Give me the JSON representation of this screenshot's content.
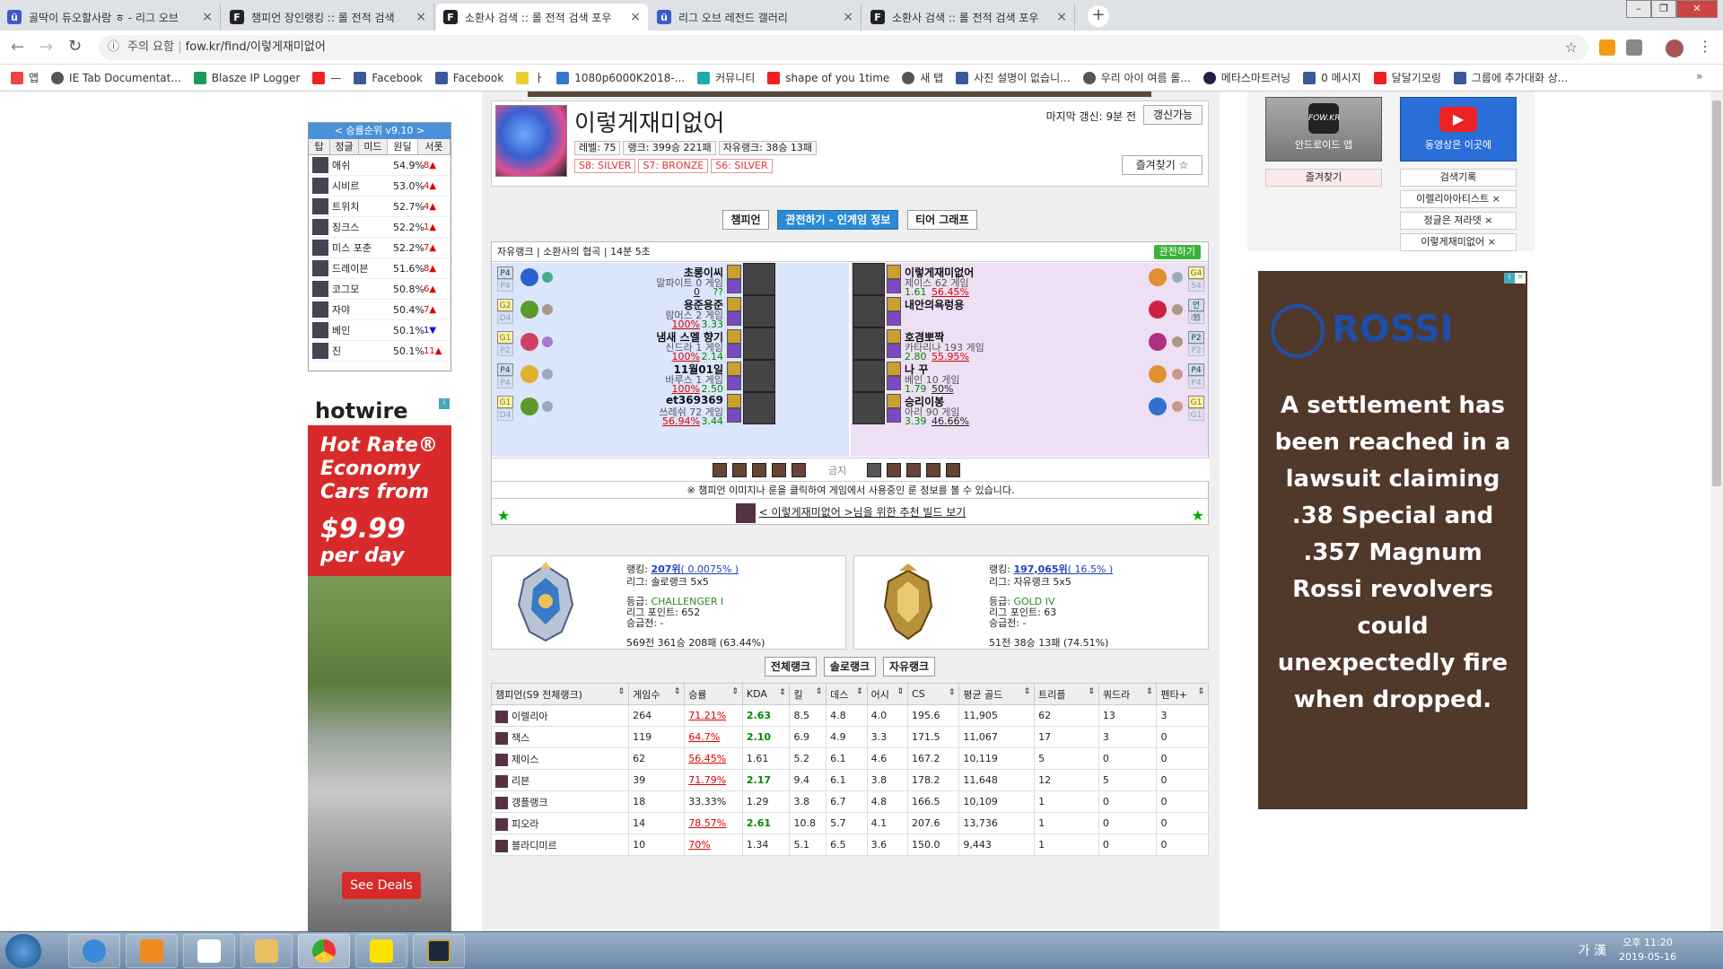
{
  "browser": {
    "tabs": [
      {
        "title": "골딱이 듀오할사람 ㅎ - 리그 오브",
        "icon": "op-icon",
        "color": "#3b5bcc"
      },
      {
        "title": "챔피언 장인랭킹 :: 롤 전적 검색",
        "icon": "fow-icon",
        "color": "#222"
      },
      {
        "title": "소환사 검색 :: 롤 전적 검색 포우",
        "icon": "fow-icon",
        "color": "#222",
        "active": true
      },
      {
        "title": "리그 오브 레전드 갤러리",
        "icon": "op-icon",
        "color": "#3b5bcc"
      },
      {
        "title": "소환사 검색 :: 롤 전적 검색 포우",
        "icon": "fow-icon",
        "color": "#222"
      }
    ],
    "url_warning": "주의 요함",
    "url": "fow.kr/find/이렇게재미없어",
    "bookmarks": [
      "앱",
      "IE Tab Documentat...",
      "Blasze IP Logger",
      "—",
      "Facebook",
      "Facebook",
      "ㅏ",
      "1080p6000K2018-...",
      "커뮤니티",
      "shape of you 1time",
      "새 탭",
      "사진 설명이 없습니...",
      "우리 아이 여름 롤...",
      "메타스마트러닝",
      "0 메시지",
      "달달기모링",
      "그룹에 추가대화 상..."
    ]
  },
  "winrank": {
    "title": "< 승률순위 v9.10 >",
    "cols": [
      "탑",
      "정글",
      "미드",
      "원딜",
      "서폿"
    ],
    "rows": [
      {
        "name": "애쉬",
        "wr": "54.9%",
        "ch": "8▲"
      },
      {
        "name": "시비르",
        "wr": "53.0%",
        "ch": "4▲"
      },
      {
        "name": "트위치",
        "wr": "52.7%",
        "ch": "4▲"
      },
      {
        "name": "징크스",
        "wr": "52.2%",
        "ch": "1▲"
      },
      {
        "name": "미스 포춘",
        "wr": "52.2%",
        "ch": "7▲"
      },
      {
        "name": "드레이븐",
        "wr": "51.6%",
        "ch": "8▲"
      },
      {
        "name": "코그모",
        "wr": "50.8%",
        "ch": "6▲"
      },
      {
        "name": "자야",
        "wr": "50.4%",
        "ch": "7▲"
      },
      {
        "name": "베인",
        "wr": "50.1%",
        "ch": "1▼"
      },
      {
        "name": "진",
        "wr": "50.1%",
        "ch": "11▲"
      }
    ]
  },
  "ad_left": {
    "brand": "hotwire",
    "line1": "Hot Rate®",
    "line2": "Economy",
    "line3": "Cars from",
    "price": "$9.99",
    "perday": "per day",
    "cta": "See Deals"
  },
  "profile": {
    "name": "이렇게재미없어",
    "level": "레벨: 75",
    "rank": "랭크: 399승 221패",
    "flex": "자유랭크: 38승 13패",
    "seasons": [
      "S8: SILVER",
      "S7: BRONZE",
      "S6: SILVER"
    ],
    "last_update": "마지막 갱신: 9분 전",
    "update_btn": "갱신가능",
    "fav_btn": "즐겨찾기 ☆"
  },
  "navtabs": [
    "챔피언",
    "관전하기 - 인게임 정보",
    "티어 그래프"
  ],
  "game": {
    "head": "자유랭크 | 소환사의 협곡 | 14분 5초",
    "spectate": "관전하기",
    "blue": [
      {
        "tier": "P4",
        "tier2": "P4",
        "name": "초롱이씨",
        "games": "말파이트 0 게임",
        "kda": "??",
        "wr": "0",
        "c1": "#2a60d0",
        "c2": "#4a8"
      },
      {
        "tier": "G2",
        "tier2": "D4",
        "name": "용준용준",
        "games": "람머스 2 게임",
        "kda": "3.33",
        "wr": "100%",
        "c1": "#5a9a2a",
        "c2": "#a98"
      },
      {
        "tier": "G1",
        "tier2": "P2",
        "name": "냄새 스멜 향기",
        "games": "신드라 1 게임",
        "kda": "2.14",
        "wr": "100%",
        "c1": "#d04060",
        "c2": "#a7c"
      },
      {
        "tier": "P4",
        "tier2": "P4",
        "name": "11월01일",
        "games": "바루스 1 게임",
        "kda": "2.50",
        "wr": "100%",
        "c1": "#e0b030",
        "c2": "#9ab"
      },
      {
        "tier": "G1",
        "tier2": "D4",
        "name": "et369369",
        "games": "쓰레쉬 72 게임",
        "kda": "3.44",
        "wr": "56.94%",
        "c1": "#5a9a2a",
        "c2": "#9ab"
      }
    ],
    "red": [
      {
        "tier": "G4",
        "tier2": "S4",
        "name": "이렇게재미없어",
        "games": "제이스 62 게임",
        "kda": "1.61",
        "wr": "56.45%",
        "c1": "#e09030",
        "c2": "#9ab"
      },
      {
        "tier": "언랭",
        "tier2": "D1",
        "name": "내안의욕렁용",
        "games": "",
        "kda": "",
        "wr": "",
        "c1": "#d02040",
        "c2": "#a98"
      },
      {
        "tier": "P2",
        "tier2": "P2",
        "name": "호겸뽀짝",
        "games": "카타리나 193 게임",
        "kda": "2.80",
        "wr": "55.95%",
        "c1": "#b03080",
        "c2": "#a98"
      },
      {
        "tier": "P4",
        "tier2": "P4",
        "name": "나 꾸",
        "games": "베인 10 게임",
        "kda": "1.79",
        "wr": "50%",
        "c1": "#e09030",
        "c2": "#c98"
      },
      {
        "tier": "G1",
        "tier2": "G1",
        "name": "승리이봉",
        "games": "아리 90 게임",
        "kda": "3.39",
        "wr": "46.66%",
        "c1": "#3070d0",
        "c2": "#c98"
      }
    ],
    "bans_label": "금지",
    "notice": "※ 챔피언 이미지나 룬을 클릭하여 게임에서 사용중인 룬 정보를 볼 수 있습니다.",
    "build_link": "< 이렇게재미없어 >님을 위한 추천 빌드 보기"
  },
  "rank_solo": {
    "rank_label": "랭킹:",
    "rank": "207위",
    "rank_pct": "( 0.0075% )",
    "league": "리그: 솔로랭크 5x5",
    "tier_label": "등급:",
    "tier": "CHALLENGER I",
    "lp": "리그 포인트: 652",
    "promo": "승급전: -",
    "record": "569전 361승 208패 (63.44%)"
  },
  "rank_flex": {
    "rank_label": "랭킹:",
    "rank": "197,065위",
    "rank_pct": "( 16.5% )",
    "league": "리그: 자유랭크 5x5",
    "tier_label": "등급:",
    "tier": "GOLD IV",
    "lp": "리그 포인트: 63",
    "promo": "승급전: -",
    "record": "51전 38승 13패 (74.51%)"
  },
  "rankbtns": [
    "전체랭크",
    "솔로랭크",
    "자유랭크"
  ],
  "stats": {
    "cols": [
      "챔피언(S9 전체랭크)",
      "게임수",
      "승률",
      "KDA",
      "킬",
      "데스",
      "어시",
      "CS",
      "평균 골드",
      "트리플",
      "쿼드라",
      "펜타+"
    ],
    "rows": [
      [
        "이렐리아",
        "264",
        "71.21%",
        "2.63",
        "8.5",
        "4.8",
        "4.0",
        "195.6",
        "11,905",
        "62",
        "13",
        "3"
      ],
      [
        "잭스",
        "119",
        "64.7%",
        "2.10",
        "6.9",
        "4.9",
        "3.3",
        "171.5",
        "11,067",
        "17",
        "3",
        "0"
      ],
      [
        "제이스",
        "62",
        "56.45%",
        "1.61",
        "5.2",
        "6.1",
        "4.6",
        "167.2",
        "10,119",
        "5",
        "0",
        "0"
      ],
      [
        "리븐",
        "39",
        "71.79%",
        "2.17",
        "9.4",
        "6.1",
        "3.8",
        "178.2",
        "11,648",
        "12",
        "5",
        "0"
      ],
      [
        "갱플랭크",
        "18",
        "33.33%",
        "1.29",
        "3.8",
        "6.7",
        "4.8",
        "166.5",
        "10,109",
        "1",
        "0",
        "0"
      ],
      [
        "피오라",
        "14",
        "78.57%",
        "2.61",
        "10.8",
        "5.7",
        "4.1",
        "207.6",
        "13,736",
        "1",
        "0",
        "0"
      ],
      [
        "블라디미르",
        "10",
        "70%",
        "1.34",
        "5.1",
        "6.5",
        "3.6",
        "150.0",
        "9,443",
        "1",
        "0",
        "0"
      ]
    ]
  },
  "right": {
    "android_label": "안드로이드 앱",
    "android_logo": "FOW.KR",
    "youtube_label": "동영상은 이곳에",
    "fav": "즐겨찾기",
    "history": "검색기록",
    "recent": [
      "이렐리아아티스트",
      "정글은 져라뎃",
      "이렇게재미없어"
    ]
  },
  "ad_right": {
    "brand": "ROSSI",
    "text": "A settlement has been reached in a lawsuit claiming .38 Special and .357 Magnum Rossi revolvers could unexpectedly fire when dropped."
  },
  "taskbar": {
    "ime": "가 漢",
    "time": "오후 11:20",
    "date": "2019-05-16"
  }
}
